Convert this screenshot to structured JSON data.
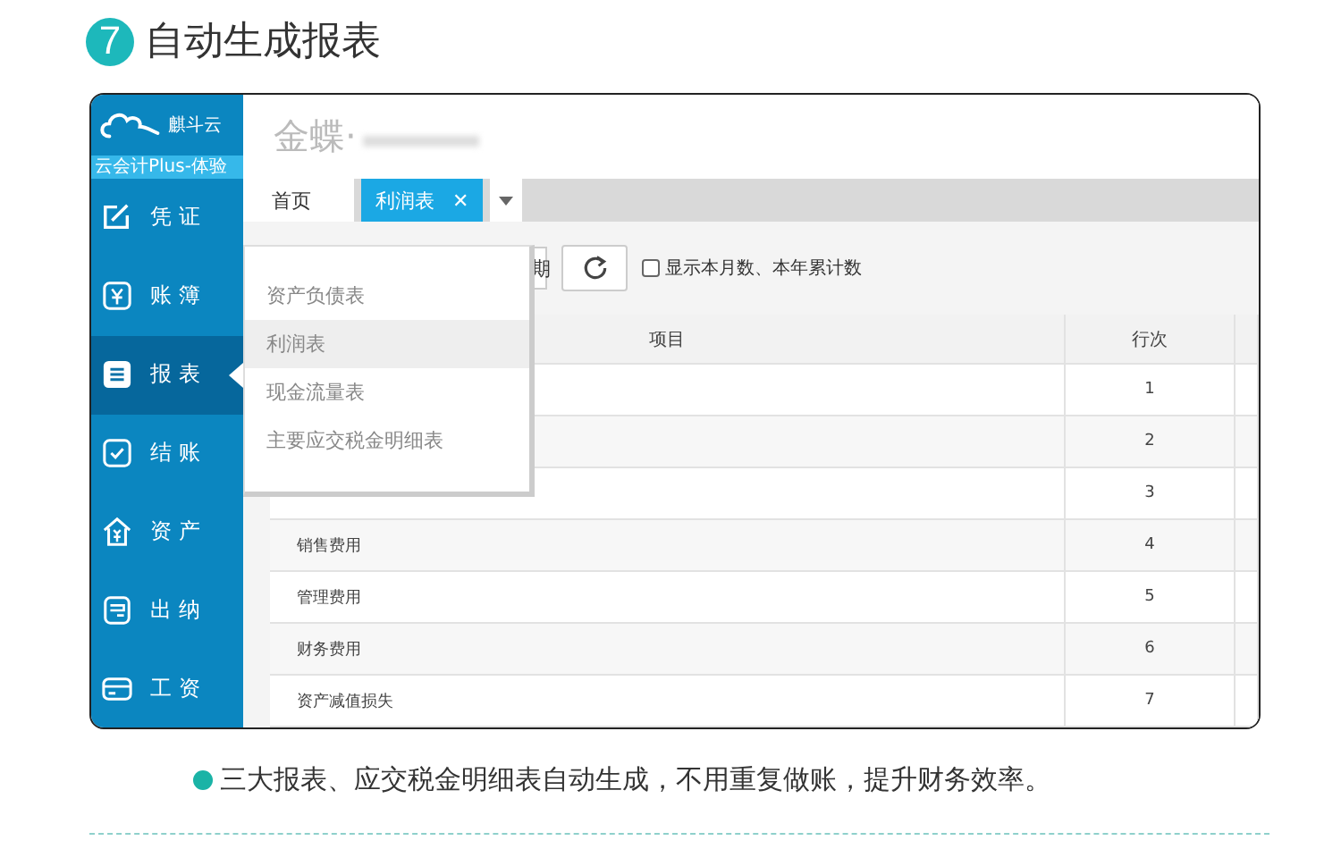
{
  "heading": {
    "number": "7",
    "title": "自动生成报表"
  },
  "app": {
    "brand": "麒斗云",
    "edition": "云会计Plus-体验",
    "company": "金蝶·",
    "nav": [
      {
        "label": "凭 证",
        "selected": false
      },
      {
        "label": "账 簿",
        "selected": false
      },
      {
        "label": "报 表",
        "selected": true
      },
      {
        "label": "结 账",
        "selected": false
      },
      {
        "label": "资 产",
        "selected": false
      },
      {
        "label": "出 纳",
        "selected": false
      },
      {
        "label": "工 资",
        "selected": false
      }
    ],
    "tabs": [
      {
        "label": "首页",
        "selected": false
      },
      {
        "label": "利润表",
        "selected": true,
        "close": "✕"
      }
    ],
    "period": "期",
    "show_totals": {
      "label": "显示本月数、本年累计数",
      "checked": false
    },
    "table": {
      "columns": [
        "项目",
        "行次"
      ],
      "rows": [
        {
          "line": "1"
        },
        {
          "line": "2"
        },
        {
          "line": "3"
        },
        {
          "item": "销售费用",
          "line": "4"
        },
        {
          "item": "管理费用",
          "line": "5"
        },
        {
          "item": "财务费用",
          "line": "6"
        },
        {
          "item": "资产减值损失",
          "line": "7"
        }
      ]
    },
    "menu": [
      {
        "label": "资产负债表",
        "selected": false
      },
      {
        "label": "利润表",
        "selected": true
      },
      {
        "label": "现金流量表",
        "selected": false
      },
      {
        "label": "主要应交税金明细表",
        "selected": false
      }
    ]
  },
  "caption": "三大报表、应交税金明细表自动生成，不用重复做账，提升财务效率。"
}
